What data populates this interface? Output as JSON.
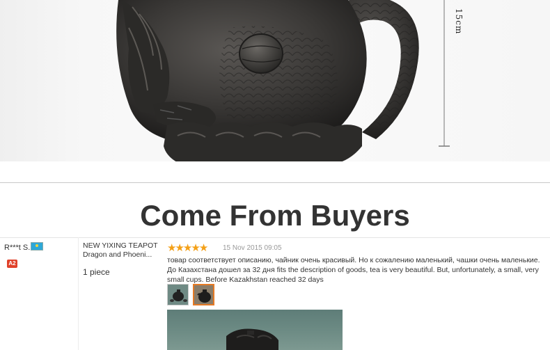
{
  "product_photo": {
    "dimension_label": "15cm",
    "colors": {
      "teapot": "#3a3836",
      "teapot_dark": "#1f1e1c",
      "background": "#f6f6f6"
    }
  },
  "section": {
    "title": "Come From Buyers"
  },
  "review": {
    "buyer_name": "R***t S.",
    "country_flag_icon": "kazakhstan-flag-icon",
    "buyer_level": "A2",
    "product_name_line1": "NEW YIXING TEAPOT",
    "product_name_line2": "Dragon and Phoeni...",
    "quantity": "1 piece",
    "rating": 5,
    "rating_max": 5,
    "date": "15 Nov 2015 09:05",
    "text": "товар соответствует описанию, чайник очень красивый. Но к сожалению маленький, чашки очень маленькие. До Казахстана дошел за 32 дня fits the description of goods, tea is very beautiful. But, unfortunately, a small, very small cups. Before Kazakhstan reached 32 days",
    "colors": {
      "star": "#f4a017",
      "badge": "#e0412a",
      "thumb_selected_border": "#e67a24"
    }
  }
}
